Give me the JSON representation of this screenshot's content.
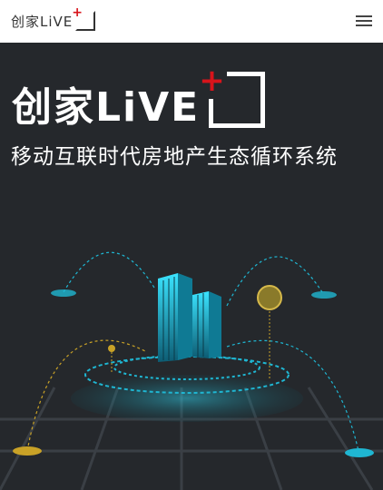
{
  "header": {
    "logo_text": "创家LiVE",
    "menu_icon": "hamburger-menu-icon"
  },
  "hero": {
    "brand_text": "创家LiVE",
    "slogan": "移动互联时代房地产生态循环系统"
  },
  "colors": {
    "accent_red": "#d8141b",
    "background_dark": "#25282c",
    "cyan": "#1fb6d2",
    "gold": "#c9a227"
  }
}
